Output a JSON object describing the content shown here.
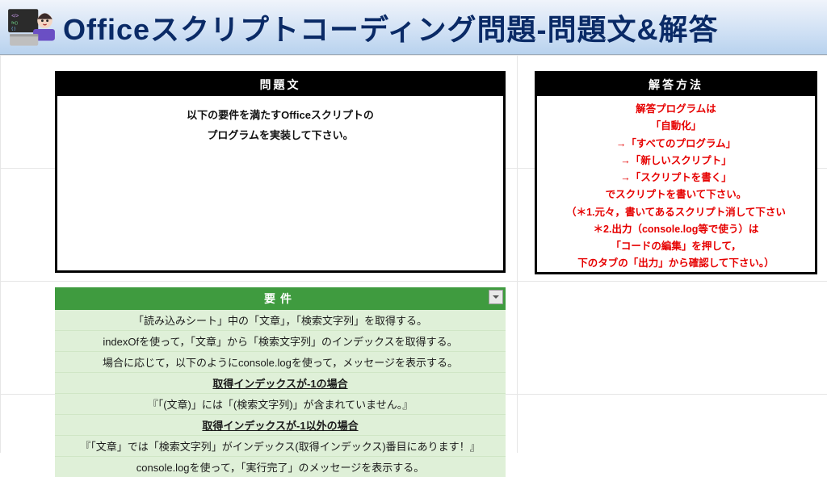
{
  "header": {
    "title": "Officeスクリプトコーディング問題-問題文&解答",
    "icon_name": "person-coding-icon"
  },
  "problem": {
    "heading": "問題文",
    "line1": "以下の要件を満たすOfficeスクリプトの",
    "line2": "プログラムを実装して下さい。"
  },
  "answer": {
    "heading": "解答方法",
    "lines": [
      "解答プログラムは",
      "「自動化」",
      "→「すべてのプログラム」",
      "→「新しいスクリプト」",
      "→「スクリプトを書く」",
      "でスクリプトを書いて下さい。",
      "（＊1.元々，書いてあるスクリプト消して下さい",
      "＊2.出力（console.log等で使う）は",
      "「コードの編集」を押して，",
      "下のタブの「出力」から確認して下さい。）"
    ]
  },
  "requirements": {
    "heading": "要件",
    "rows": [
      {
        "text": "「読み込みシート」中の「文章」，「検索文字列」を取得する。",
        "bold": false
      },
      {
        "text": "indexOfを使って，「文章」から「検索文字列」のインデックスを取得する。",
        "bold": false
      },
      {
        "text": "場合に応じて，以下のようにconsole.logを使って，メッセージを表示する。",
        "bold": false
      },
      {
        "text": "取得インデックスが-1の場合",
        "bold": true
      },
      {
        "text": "『「(文章)」には「(検索文字列)」が含まれていません。』",
        "bold": false
      },
      {
        "text": "取得インデックスが-1以外の場合",
        "bold": true
      },
      {
        "text": "『「文章」では「検索文字列」がインデックス(取得インデックス)番目にあります！』",
        "bold": false
      },
      {
        "text": "console.logを使って，「実行完了」のメッセージを表示する。",
        "bold": false
      }
    ]
  }
}
